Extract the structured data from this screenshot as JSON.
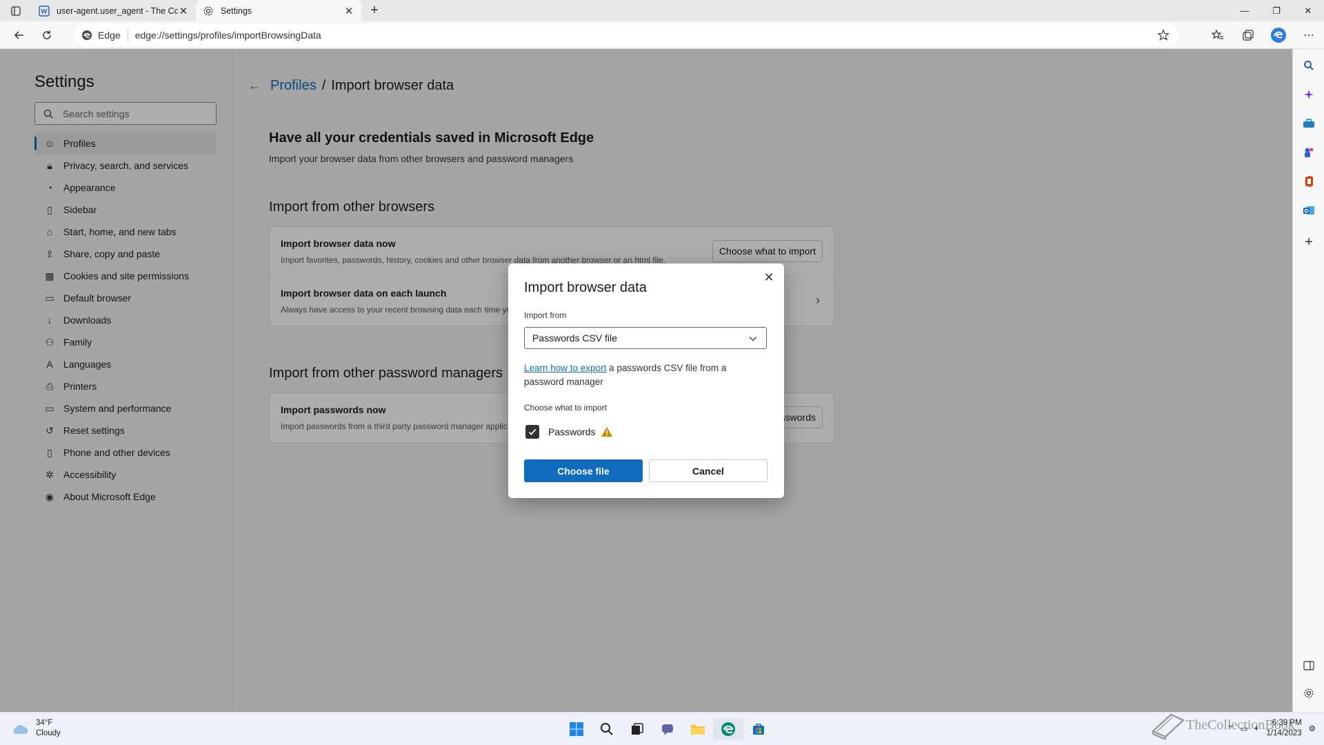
{
  "browser": {
    "tabs": [
      {
        "title": "user-agent.user_agent - The Coll",
        "active": false
      },
      {
        "title": "Settings",
        "active": true
      }
    ],
    "address": {
      "brand": "Edge",
      "url": "edge://settings/profiles/importBrowsingData"
    }
  },
  "settings": {
    "title": "Settings",
    "search_placeholder": "Search settings",
    "nav": [
      {
        "label": "Profiles",
        "icon": "profile-icon",
        "selected": true
      },
      {
        "label": "Privacy, search, and services",
        "icon": "lock-icon"
      },
      {
        "label": "Appearance",
        "icon": "appearance-icon"
      },
      {
        "label": "Sidebar",
        "icon": "sidebar-icon"
      },
      {
        "label": "Start, home, and new tabs",
        "icon": "home-icon"
      },
      {
        "label": "Share, copy and paste",
        "icon": "share-icon"
      },
      {
        "label": "Cookies and site permissions",
        "icon": "cookie-icon"
      },
      {
        "label": "Default browser",
        "icon": "browser-icon"
      },
      {
        "label": "Downloads",
        "icon": "download-icon"
      },
      {
        "label": "Family",
        "icon": "family-icon"
      },
      {
        "label": "Languages",
        "icon": "language-icon"
      },
      {
        "label": "Printers",
        "icon": "printer-icon"
      },
      {
        "label": "System and performance",
        "icon": "system-icon"
      },
      {
        "label": "Reset settings",
        "icon": "reset-icon"
      },
      {
        "label": "Phone and other devices",
        "icon": "phone-icon"
      },
      {
        "label": "Accessibility",
        "icon": "accessibility-icon"
      },
      {
        "label": "About Microsoft Edge",
        "icon": "edge-icon"
      }
    ]
  },
  "page": {
    "breadcrumb_parent": "Profiles",
    "breadcrumb_sep": "/",
    "breadcrumb_current": "Import browser data",
    "hero_title": "Have all your credentials saved in Microsoft Edge",
    "hero_subtitle": "Import your browser data from other browsers and password managers",
    "section_browsers": "Import from other browsers",
    "row_import_now_title": "Import browser data now",
    "row_import_now_desc": "Import favorites, passwords, history, cookies and other browser data from another browser or an html file.",
    "row_import_now_button": "Choose what to import",
    "row_launch_title": "Import browser data on each launch",
    "row_launch_desc": "Always have access to your recent browsing data each time you",
    "section_pw": "Import from other password managers",
    "row_pw_title": "Import passwords now",
    "row_pw_desc": "Import passwords from a third party password manager applic",
    "row_pw_button": "sswords"
  },
  "dialog": {
    "title": "Import browser data",
    "import_from_label": "Import from",
    "import_from_value": "Passwords CSV file",
    "help_link": "Learn how to export",
    "help_text": " a passwords CSV file from a password manager",
    "choose_label": "Choose what to import",
    "checkbox_label": "Passwords",
    "checkbox_checked": true,
    "primary_button": "Choose file",
    "secondary_button": "Cancel"
  },
  "taskbar": {
    "weather_temp": "34°F",
    "weather_desc": "Cloudy",
    "time": "6:39 PM",
    "date": "1/14/2023",
    "watermark": "TheCollectionBook"
  },
  "colors": {
    "accent": "#0f6cbd",
    "warning": "#c88a00"
  }
}
